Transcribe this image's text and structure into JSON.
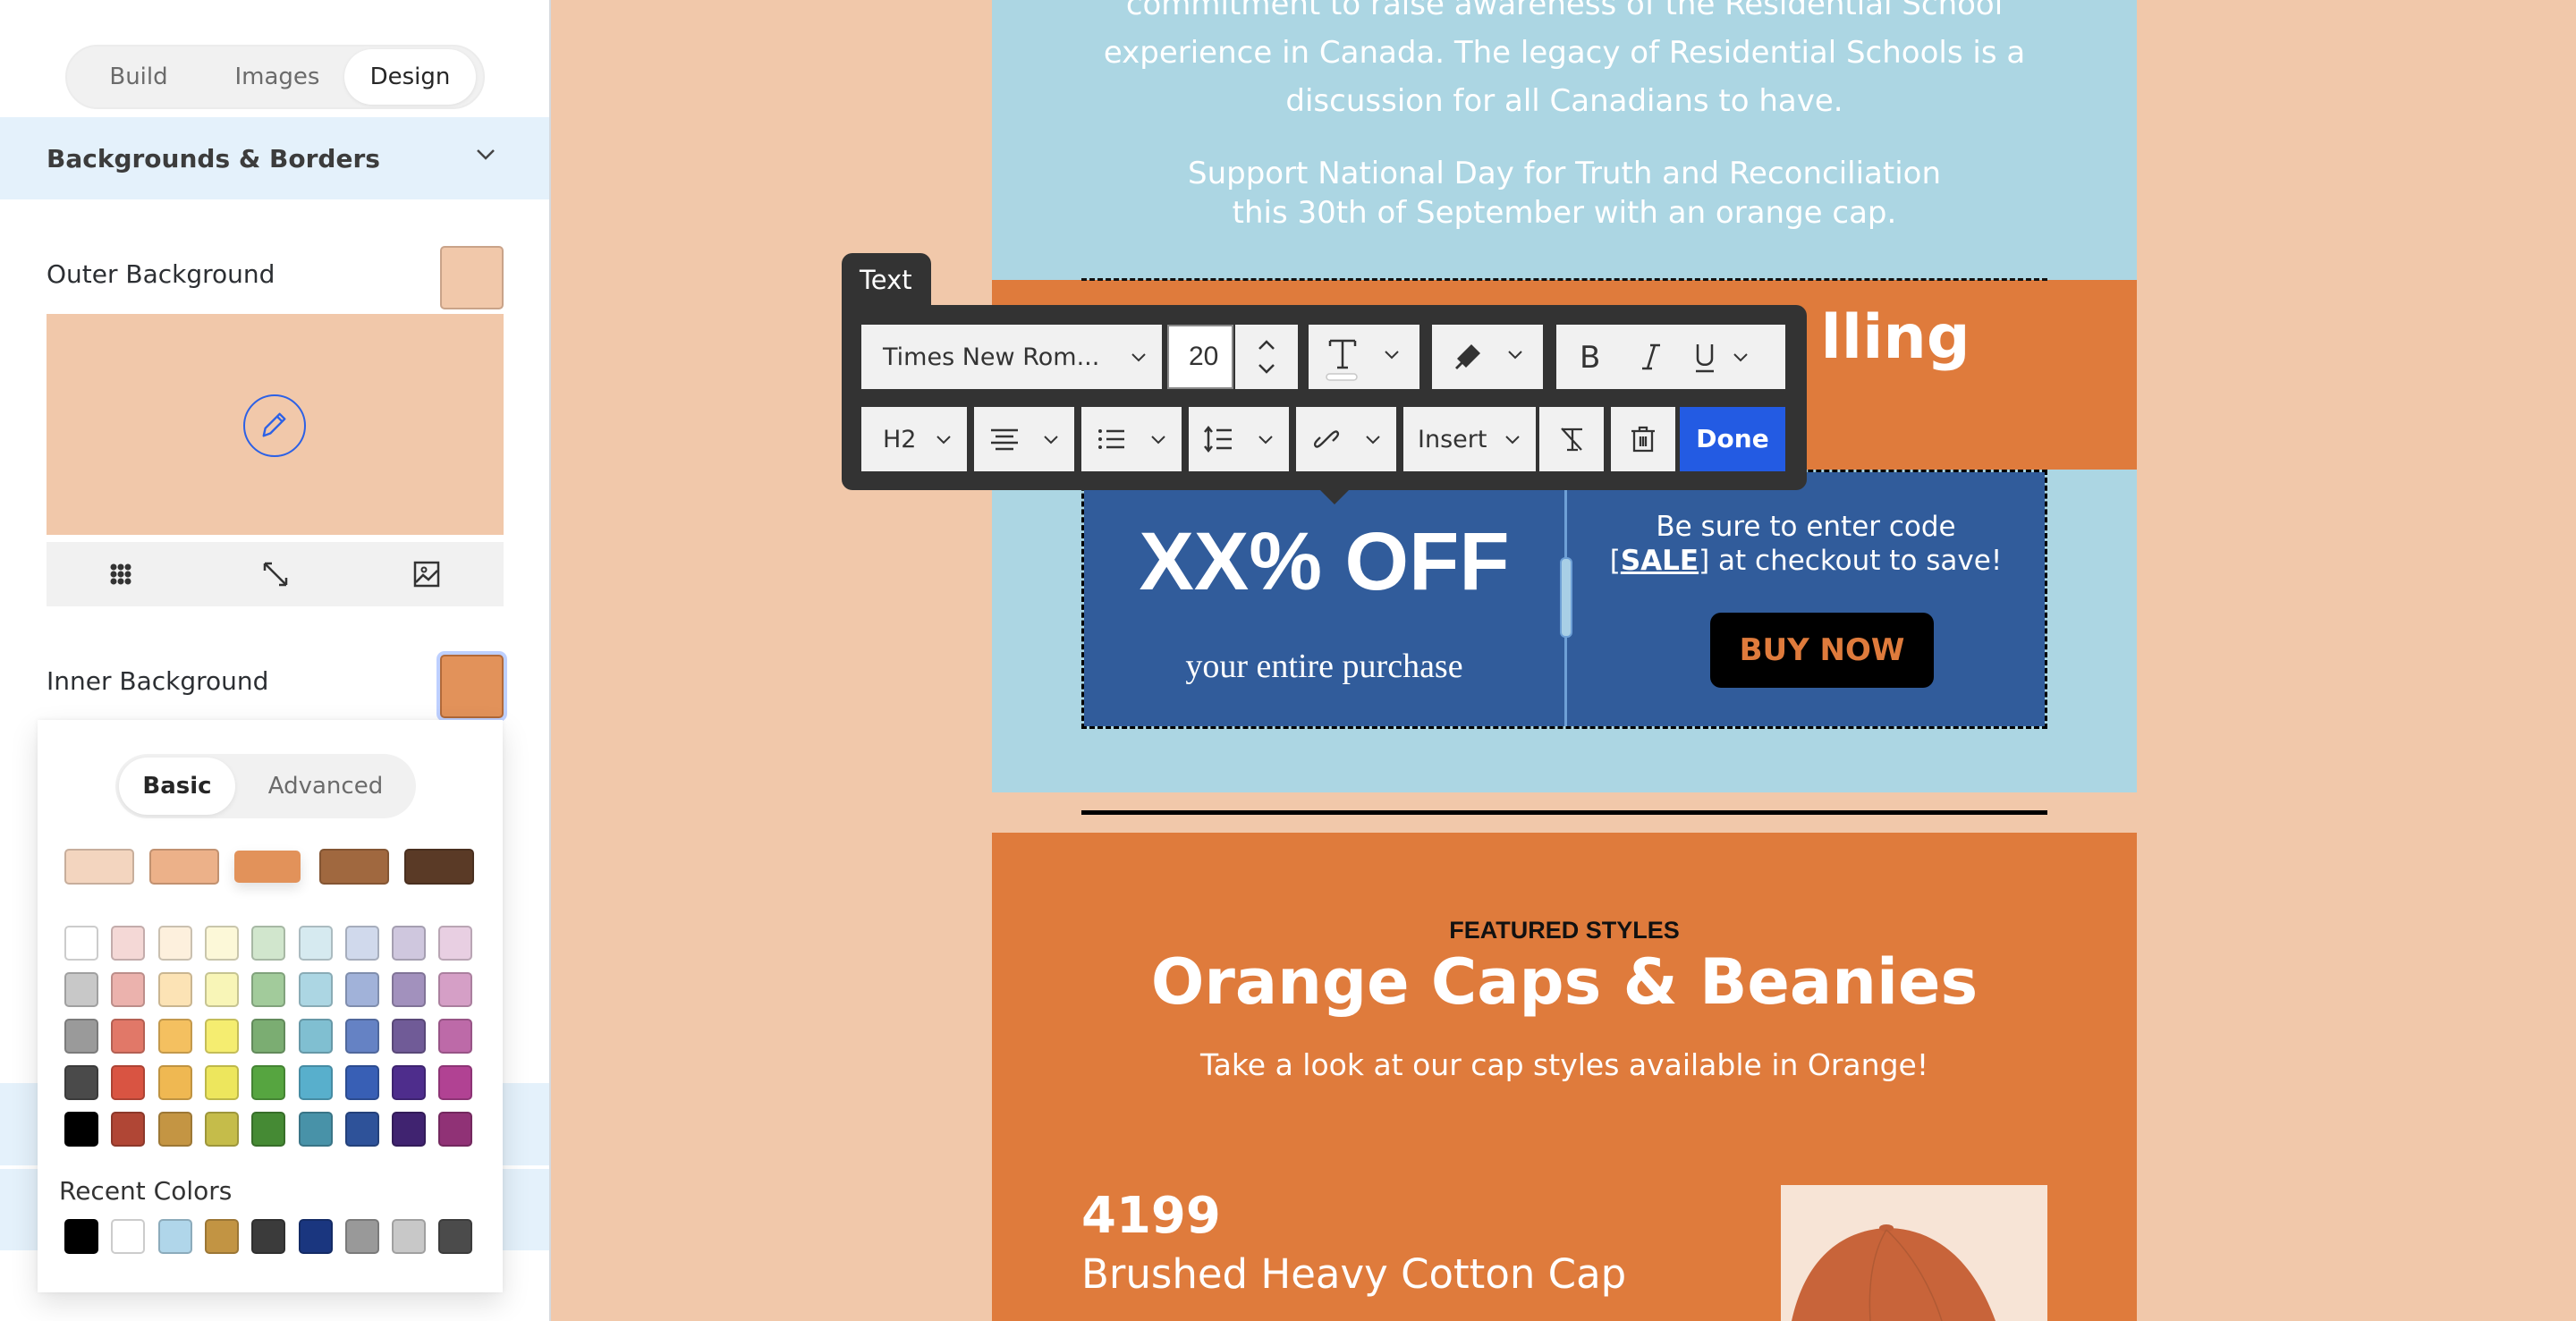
{
  "sidebar": {
    "tabs": [
      {
        "label": "Build",
        "active": false
      },
      {
        "label": "Images",
        "active": false
      },
      {
        "label": "Design",
        "active": true
      }
    ],
    "section_title": "Backgrounds & Borders",
    "outer_background": {
      "label": "Outer Background",
      "color": "#f1c8aa"
    },
    "inner_background": {
      "label": "Inner Background",
      "color": "#e2925a"
    },
    "preview_tools": [
      "pattern-grid-icon",
      "expand-icon",
      "image-icon"
    ]
  },
  "color_picker": {
    "tabs": [
      {
        "label": "Basic",
        "active": true
      },
      {
        "label": "Advanced",
        "active": false
      }
    ],
    "theme_colors": [
      "#f3d5bf",
      "#ecb189",
      "#e2925a",
      "#a0683f",
      "#5a3a26"
    ],
    "selected_theme_index": 2,
    "palette": [
      [
        "#ffffff",
        "#f4d8d6",
        "#fdf0dd",
        "#fcf8d8",
        "#d1e6cd",
        "#d6eaf0",
        "#d0d9ec",
        "#cfc7de",
        "#e8cfe2"
      ],
      [
        "#c8c8c8",
        "#ebb2ad",
        "#fce3b5",
        "#f8f5b7",
        "#a2cb9b",
        "#acd6e3",
        "#a1b2d9",
        "#a291bd",
        "#d59fc6"
      ],
      [
        "#9a9a9a",
        "#e17868",
        "#f4c060",
        "#f5ed70",
        "#7bad72",
        "#80bfd1",
        "#6582c4",
        "#705b97",
        "#bd6aa8"
      ],
      [
        "#4a4a4a",
        "#d95442",
        "#efb852",
        "#ede65d",
        "#56a540",
        "#58afcc",
        "#385fb5",
        "#4e2d8c",
        "#b14293"
      ],
      [
        "#000000",
        "#b04635",
        "#c49543",
        "#c5bc4a",
        "#458a34",
        "#4892a8",
        "#2e5299",
        "#402370",
        "#903276"
      ]
    ],
    "recent_label": "Recent Colors",
    "recent_colors": [
      "#000000",
      "#ffffff",
      "#b0d6ea",
      "#c29443",
      "#3b3b3b",
      "#1a367f",
      "#999999",
      "#c8c8c8",
      "#4b4b4b"
    ]
  },
  "toolbar": {
    "tab_label": "Text",
    "font_family": "Times New Rom...",
    "font_size": "20",
    "heading": "H2",
    "insert_label": "Insert",
    "done_label": "Done"
  },
  "email": {
    "intro_lines": [
      "commitment to raise awareness of the Residential School",
      "experience in Canada. The legacy of Residential Schools is a",
      "discussion for all Canadians to have."
    ],
    "support_lines": [
      "Support National Day for Truth and Reconciliation",
      "this 30th of September with an orange cap."
    ],
    "headline_visible": "lling",
    "coupon": {
      "discount": "XX% OFF",
      "subtitle": "your entire purchase",
      "code_line1": "Be sure to enter code",
      "code_open": "[",
      "code": "SALE",
      "code_close": "] at checkout to save!",
      "button": "BUY NOW"
    },
    "featured_label": "FEATURED STYLES",
    "featured_title": "Orange Caps & Beanies",
    "featured_subtitle": "Take a look at our cap styles available in Orange!",
    "product": {
      "number": "4199",
      "name": "Brushed Heavy Cotton Cap"
    }
  },
  "colors": {
    "outer_bg": "#f1c8aa",
    "light_blue": "#acd6e3",
    "orange": "#df7b3c",
    "coupon_blue": "#315c9b",
    "accent_blue": "#235be3"
  }
}
